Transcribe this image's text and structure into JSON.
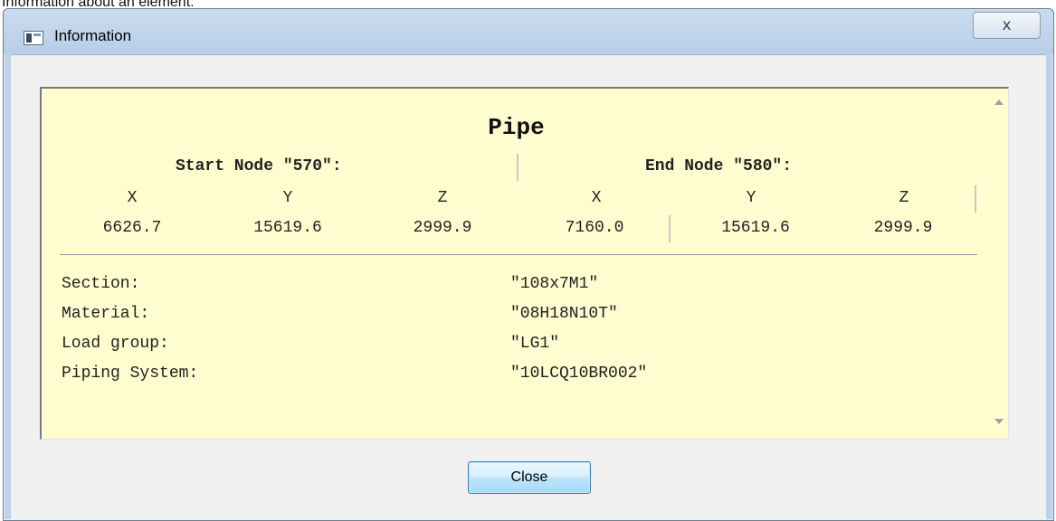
{
  "caption": "Information about an element:",
  "window": {
    "title": "Information",
    "close_glyph": "ⅹ"
  },
  "element": {
    "type_title": "Pipe",
    "start_node_label": "Start Node \"570\":",
    "end_node_label": "End Node \"580\":",
    "axes": [
      "X",
      "Y",
      "Z",
      "X",
      "Y",
      "Z"
    ],
    "start": {
      "x": "6626.7",
      "y": "15619.6",
      "z": "2999.9"
    },
    "end": {
      "x": "7160.0",
      "y": "15619.6",
      "z": "2999.9"
    }
  },
  "properties": [
    {
      "name": "Section:",
      "value": "\"108x7M1\""
    },
    {
      "name": "Material:",
      "value": "\"08H18N10T\""
    },
    {
      "name": "Load group:",
      "value": "\"LG1\""
    },
    {
      "name": "Piping System:",
      "value": "\"10LCQ10BR002\""
    }
  ],
  "buttons": {
    "close_label": "Close"
  },
  "icons": {
    "app": "window-app-icon",
    "close": "close-x-icon",
    "scroll_up": "scroll-up-arrow-icon",
    "scroll_down": "scroll-down-arrow-icon"
  }
}
